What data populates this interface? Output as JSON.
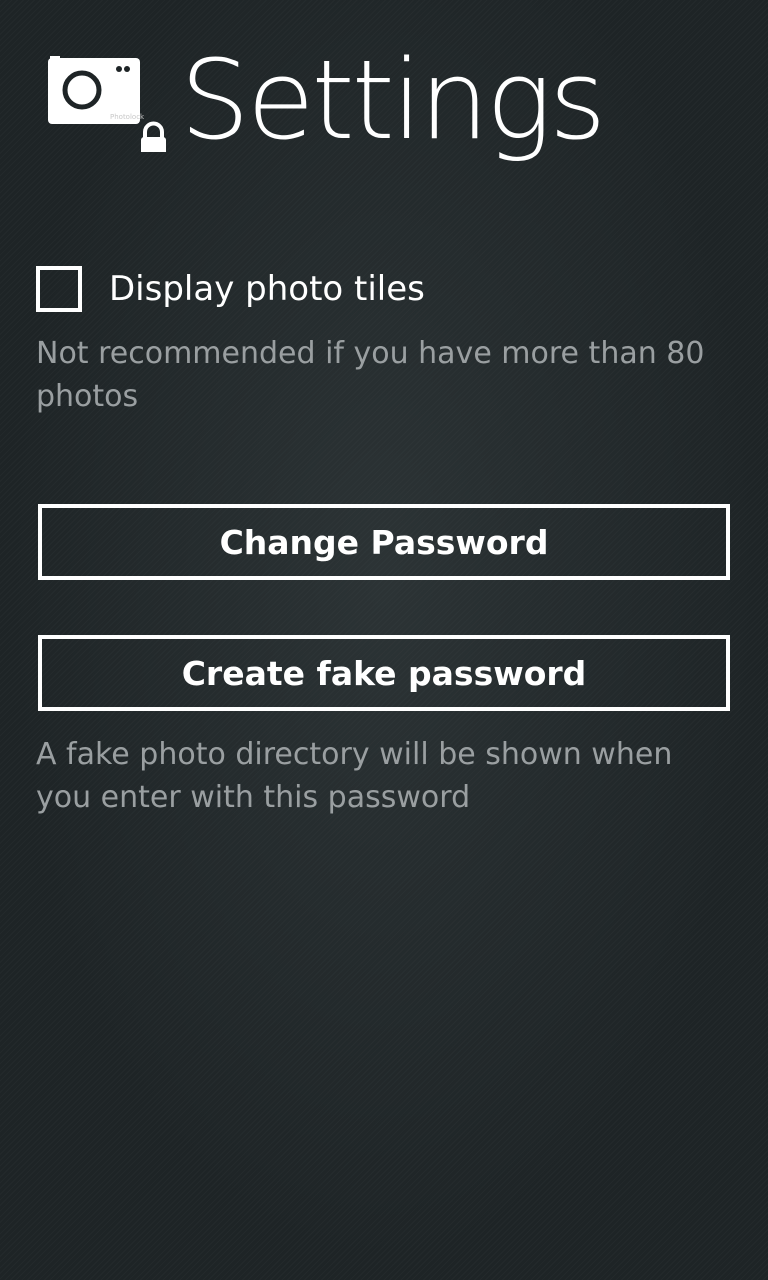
{
  "header": {
    "title": "Settings",
    "logo_icon": "camera-lock-icon",
    "logo_text": "Photolock"
  },
  "settings": {
    "display_photo_tiles": {
      "label": "Display photo tiles",
      "checked": false,
      "hint": "Not recommended if you have more than 80 photos"
    },
    "change_password": {
      "label": "Change Password"
    },
    "fake_password": {
      "label": "Create fake password",
      "hint": "A fake photo directory will be shown when you enter with this password"
    }
  },
  "colors": {
    "background": "#1e2426",
    "foreground": "#ffffff",
    "hint_text": "#9a9fa1"
  }
}
